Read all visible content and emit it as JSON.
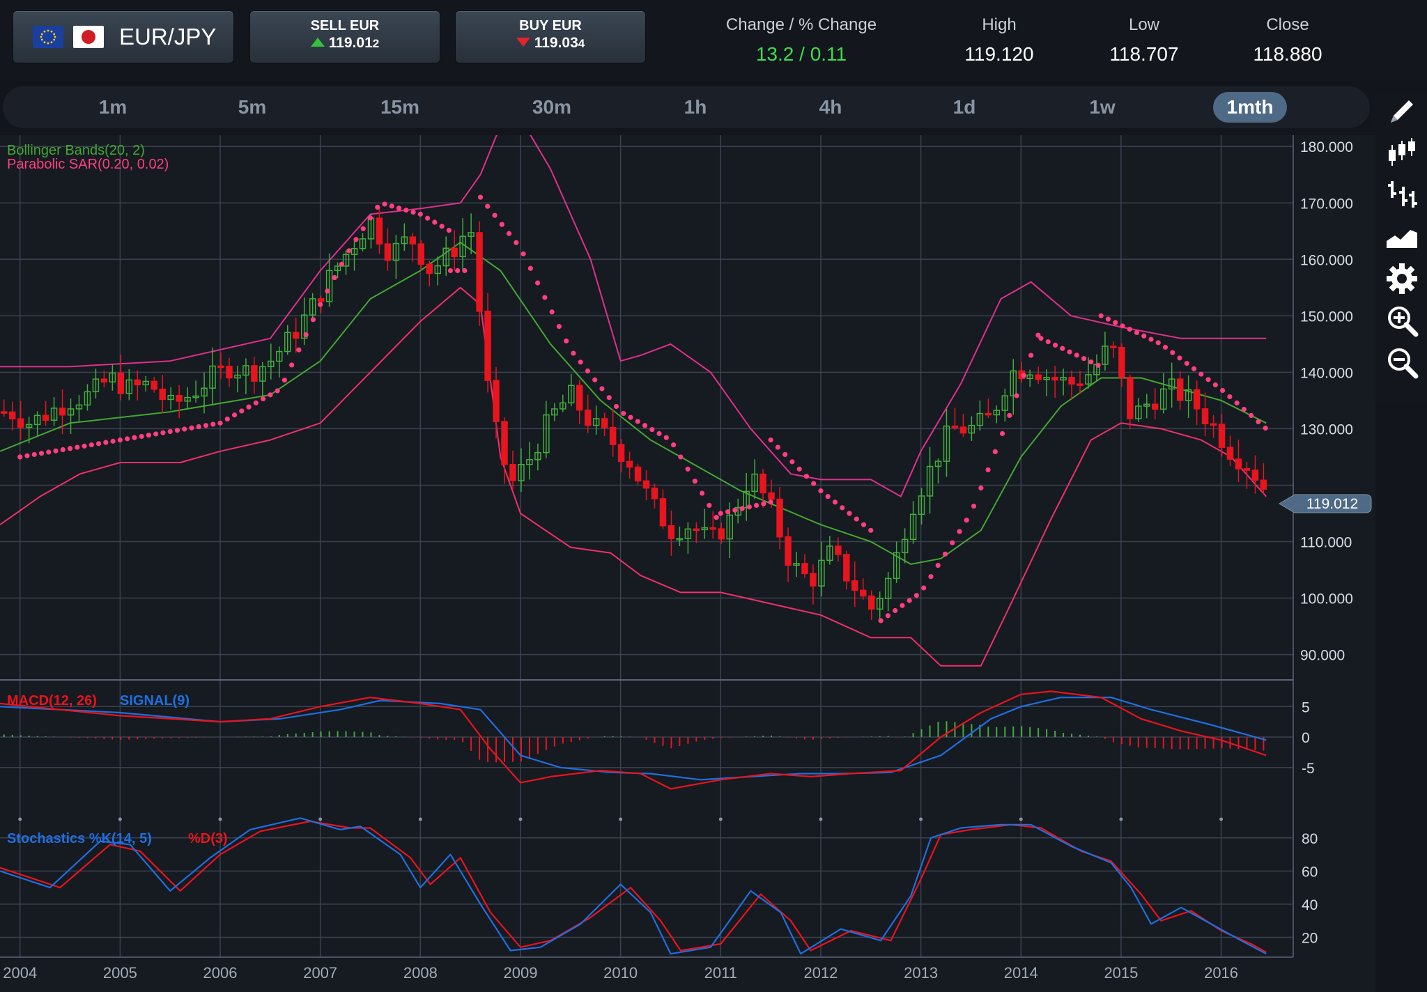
{
  "header": {
    "pair": "EUR/JPY",
    "sell": {
      "label": "SELL EUR",
      "price_main": "119.01",
      "price_tail": "2"
    },
    "buy": {
      "label": "BUY EUR",
      "price_main": "119.03",
      "price_tail": "4"
    },
    "change_label": "Change / % Change",
    "change_value": "13.2 / 0.11",
    "high_label": "High",
    "high_value": "119.120",
    "low_label": "Low",
    "low_value": "118.707",
    "close_label": "Close",
    "close_value": "118.880"
  },
  "timeframes": [
    "1m",
    "5m",
    "15m",
    "30m",
    "1h",
    "4h",
    "1d",
    "1w",
    "1mth"
  ],
  "active_timeframe": "1mth",
  "tools": [
    "pencil-icon",
    "candlestick-icon",
    "ohlc-bars-icon",
    "area-chart-icon",
    "gear-icon",
    "zoom-in-icon",
    "zoom-out-icon"
  ],
  "colors": {
    "bollinger": "#43a832",
    "sar": "#ff3f7f",
    "up": "#3fae3a",
    "down": "#e8141e",
    "macd": "#e8141e",
    "signal": "#1f6fe0",
    "price_tag": "#4e6a86"
  },
  "chart_data": [
    {
      "type": "candlestick",
      "indicators": [
        "Bollinger Bands(20, 2)",
        "Parabolic SAR(0.20, 0.02)"
      ],
      "price_tag": "119.012",
      "y_ticks": [
        "180.000",
        "170.000",
        "160.000",
        "150.000",
        "140.000",
        "130.000",
        "110.000",
        "100.000",
        "90.000"
      ],
      "ylim": [
        86,
        182
      ],
      "x_ticks": [
        "2004",
        "2005",
        "2006",
        "2007",
        "2008",
        "2009",
        "2010",
        "2011",
        "2012",
        "2013",
        "2014",
        "2015",
        "2016"
      ],
      "xlim": [
        2003.8,
        2016.72
      ],
      "grid": true,
      "close_series": [
        [
          2003.9,
          133
        ],
        [
          2004.1,
          131
        ],
        [
          2004.3,
          133
        ],
        [
          2004.5,
          135
        ],
        [
          2004.7,
          136
        ],
        [
          2004.9,
          139
        ],
        [
          2005.1,
          137
        ],
        [
          2005.3,
          138
        ],
        [
          2005.5,
          134
        ],
        [
          2005.7,
          136
        ],
        [
          2005.9,
          139
        ],
        [
          2006.1,
          141
        ],
        [
          2006.3,
          140
        ],
        [
          2006.5,
          142
        ],
        [
          2006.7,
          146
        ],
        [
          2006.9,
          151
        ],
        [
          2007.1,
          157
        ],
        [
          2007.3,
          162
        ],
        [
          2007.5,
          167
        ],
        [
          2007.7,
          161
        ],
        [
          2007.9,
          164
        ],
        [
          2008.1,
          158
        ],
        [
          2008.3,
          161
        ],
        [
          2008.5,
          166
        ],
        [
          2008.7,
          133
        ],
        [
          2008.9,
          120
        ],
        [
          2009.1,
          125
        ],
        [
          2009.3,
          132
        ],
        [
          2009.5,
          136
        ],
        [
          2009.7,
          131
        ],
        [
          2009.9,
          128
        ],
        [
          2010.1,
          124
        ],
        [
          2010.3,
          117
        ],
        [
          2010.5,
          112
        ],
        [
          2010.7,
          113
        ],
        [
          2010.9,
          110
        ],
        [
          2011.1,
          114
        ],
        [
          2011.3,
          122
        ],
        [
          2011.5,
          116
        ],
        [
          2011.7,
          106
        ],
        [
          2011.9,
          103
        ],
        [
          2012.1,
          108
        ],
        [
          2012.3,
          103
        ],
        [
          2012.5,
          98
        ],
        [
          2012.7,
          104
        ],
        [
          2012.9,
          116
        ],
        [
          2013.1,
          123
        ],
        [
          2013.3,
          130
        ],
        [
          2013.5,
          130
        ],
        [
          2013.7,
          132
        ],
        [
          2013.9,
          140
        ],
        [
          2014.1,
          141
        ],
        [
          2014.3,
          139
        ],
        [
          2014.5,
          138
        ],
        [
          2014.7,
          140
        ],
        [
          2014.9,
          145
        ],
        [
          2015.1,
          132
        ],
        [
          2015.3,
          135
        ],
        [
          2015.5,
          137
        ],
        [
          2015.7,
          135
        ],
        [
          2015.9,
          131
        ],
        [
          2016.1,
          126
        ],
        [
          2016.3,
          123
        ],
        [
          2016.45,
          119
        ]
      ],
      "bollinger_upper": [
        [
          2003.8,
          141
        ],
        [
          2004.5,
          141
        ],
        [
          2005.5,
          142
        ],
        [
          2006.5,
          146
        ],
        [
          2007.0,
          158
        ],
        [
          2007.5,
          168
        ],
        [
          2008.0,
          169
        ],
        [
          2008.4,
          170
        ],
        [
          2008.6,
          175
        ],
        [
          2008.9,
          188
        ],
        [
          2009.3,
          176
        ],
        [
          2009.7,
          160
        ],
        [
          2010.0,
          142
        ],
        [
          2010.2,
          143
        ],
        [
          2010.5,
          145
        ],
        [
          2010.9,
          140
        ],
        [
          2011.3,
          130
        ],
        [
          2011.7,
          122
        ],
        [
          2012.0,
          121
        ],
        [
          2012.5,
          121
        ],
        [
          2012.8,
          118
        ],
        [
          2013.0,
          126
        ],
        [
          2013.4,
          138
        ],
        [
          2013.8,
          153
        ],
        [
          2014.1,
          156
        ],
        [
          2014.5,
          150
        ],
        [
          2015.0,
          148
        ],
        [
          2015.6,
          146
        ],
        [
          2016.0,
          146
        ],
        [
          2016.45,
          146
        ]
      ],
      "bollinger_mid": [
        [
          2003.8,
          126
        ],
        [
          2004.5,
          131
        ],
        [
          2005.5,
          133
        ],
        [
          2006.5,
          136
        ],
        [
          2007.0,
          142
        ],
        [
          2007.5,
          153
        ],
        [
          2008.0,
          158
        ],
        [
          2008.4,
          163
        ],
        [
          2008.8,
          158
        ],
        [
          2009.3,
          145
        ],
        [
          2009.8,
          135
        ],
        [
          2010.3,
          128
        ],
        [
          2010.7,
          124
        ],
        [
          2011.2,
          119
        ],
        [
          2011.6,
          116
        ],
        [
          2012.0,
          113
        ],
        [
          2012.5,
          110
        ],
        [
          2012.9,
          106
        ],
        [
          2013.2,
          107
        ],
        [
          2013.6,
          112
        ],
        [
          2014.0,
          125
        ],
        [
          2014.4,
          134
        ],
        [
          2014.8,
          139
        ],
        [
          2015.2,
          139
        ],
        [
          2015.6,
          137
        ],
        [
          2016.0,
          135
        ],
        [
          2016.45,
          131
        ]
      ],
      "bollinger_lower": [
        [
          2003.8,
          113
        ],
        [
          2004.2,
          118
        ],
        [
          2004.6,
          122
        ],
        [
          2005.0,
          124
        ],
        [
          2005.6,
          124
        ],
        [
          2006.0,
          126
        ],
        [
          2006.5,
          128
        ],
        [
          2007.0,
          131
        ],
        [
          2007.5,
          140
        ],
        [
          2008.0,
          149
        ],
        [
          2008.4,
          155
        ],
        [
          2008.6,
          152
        ],
        [
          2008.8,
          125
        ],
        [
          2009.0,
          115
        ],
        [
          2009.5,
          109
        ],
        [
          2009.9,
          108
        ],
        [
          2010.2,
          104
        ],
        [
          2010.6,
          101
        ],
        [
          2011.0,
          101
        ],
        [
          2011.5,
          99
        ],
        [
          2012.0,
          97
        ],
        [
          2012.5,
          93
        ],
        [
          2012.9,
          93
        ],
        [
          2013.2,
          88
        ],
        [
          2013.6,
          88
        ],
        [
          2013.9,
          99
        ],
        [
          2014.3,
          114
        ],
        [
          2014.7,
          128
        ],
        [
          2015.0,
          131
        ],
        [
          2015.4,
          130
        ],
        [
          2015.8,
          128
        ],
        [
          2016.1,
          125
        ],
        [
          2016.45,
          118
        ]
      ],
      "sar_series": [
        [
          [
            2004.0,
            125
          ],
          [
            2005.0,
            128
          ],
          [
            2006.0,
            131
          ],
          [
            2006.6,
            137
          ],
          [
            2007.0,
            152
          ],
          [
            2007.3,
            162
          ],
          [
            2007.6,
            170
          ],
          [
            2008.0,
            168
          ],
          [
            2008.3,
            165
          ]
        ],
        [
          [
            2008.3,
            158
          ],
          [
            2008.5,
            158
          ]
        ],
        [
          [
            2008.6,
            171
          ],
          [
            2009.0,
            162
          ],
          [
            2009.5,
            144
          ],
          [
            2010.0,
            133
          ],
          [
            2010.5,
            128
          ],
          [
            2011.0,
            113
          ]
        ],
        [
          [
            2011.0,
            115
          ],
          [
            2011.5,
            117
          ]
        ],
        [
          [
            2011.5,
            128
          ],
          [
            2012.0,
            119
          ],
          [
            2012.5,
            112
          ]
        ],
        [
          [
            2012.6,
            96
          ],
          [
            2013.0,
            101
          ],
          [
            2013.5,
            115
          ],
          [
            2013.9,
            133
          ],
          [
            2014.2,
            148
          ]
        ],
        [
          [
            2014.2,
            146
          ],
          [
            2014.8,
            141
          ]
        ],
        [
          [
            2014.8,
            150
          ],
          [
            2015.4,
            145
          ],
          [
            2016.0,
            137
          ],
          [
            2016.45,
            130
          ]
        ]
      ]
    },
    {
      "type": "line",
      "indicator": "MACD(12, 26)",
      "signal_label": "SIGNAL(9)",
      "y_ticks": [
        "5",
        "0",
        "-5"
      ],
      "ylim": [
        -8,
        8
      ],
      "macd": [
        [
          2003.8,
          5.5
        ],
        [
          2005.0,
          3.5
        ],
        [
          2006.0,
          2.5
        ],
        [
          2006.5,
          3
        ],
        [
          2007.0,
          5
        ],
        [
          2007.5,
          6.5
        ],
        [
          2008.0,
          5.5
        ],
        [
          2008.4,
          4.5
        ],
        [
          2008.7,
          -2
        ],
        [
          2009.0,
          -7.5
        ],
        [
          2009.3,
          -6.5
        ],
        [
          2009.8,
          -5.5
        ],
        [
          2010.2,
          -6
        ],
        [
          2010.5,
          -8.5
        ],
        [
          2011.0,
          -7
        ],
        [
          2011.5,
          -6
        ],
        [
          2011.9,
          -6.5
        ],
        [
          2012.3,
          -6
        ],
        [
          2012.8,
          -5.5
        ],
        [
          2013.2,
          0
        ],
        [
          2013.6,
          4
        ],
        [
          2014.0,
          7
        ],
        [
          2014.3,
          7.5
        ],
        [
          2014.8,
          6.5
        ],
        [
          2015.2,
          3
        ],
        [
          2015.6,
          1
        ],
        [
          2016.0,
          -0.5
        ],
        [
          2016.45,
          -3
        ]
      ],
      "signal": [
        [
          2003.8,
          5
        ],
        [
          2005.0,
          4
        ],
        [
          2006.0,
          2.5
        ],
        [
          2006.6,
          3
        ],
        [
          2007.2,
          4.5
        ],
        [
          2007.6,
          6
        ],
        [
          2008.2,
          5.5
        ],
        [
          2008.6,
          4.5
        ],
        [
          2009.0,
          -3
        ],
        [
          2009.4,
          -5
        ],
        [
          2009.9,
          -5.8
        ],
        [
          2010.3,
          -6
        ],
        [
          2010.8,
          -7
        ],
        [
          2011.3,
          -6.5
        ],
        [
          2011.8,
          -6
        ],
        [
          2012.2,
          -6
        ],
        [
          2012.7,
          -5.8
        ],
        [
          2013.2,
          -3
        ],
        [
          2013.7,
          3
        ],
        [
          2014.0,
          5
        ],
        [
          2014.4,
          6.5
        ],
        [
          2014.9,
          6.5
        ],
        [
          2015.3,
          4.5
        ],
        [
          2015.9,
          2
        ],
        [
          2016.45,
          -0.5
        ]
      ]
    },
    {
      "type": "line",
      "indicator": "Stochastics %K(14, 5)",
      "signal_label": "%D(3)",
      "y_ticks": [
        "80",
        "60",
        "40",
        "20"
      ],
      "ylim": [
        8,
        98
      ],
      "k": [
        [
          2003.8,
          60
        ],
        [
          2004.3,
          50
        ],
        [
          2004.8,
          78
        ],
        [
          2005.1,
          76
        ],
        [
          2005.5,
          48
        ],
        [
          2005.9,
          68
        ],
        [
          2006.3,
          85
        ],
        [
          2006.8,
          92
        ],
        [
          2007.2,
          85
        ],
        [
          2007.4,
          87
        ],
        [
          2007.8,
          70
        ],
        [
          2008.0,
          50
        ],
        [
          2008.3,
          70
        ],
        [
          2008.6,
          40
        ],
        [
          2008.9,
          12
        ],
        [
          2009.2,
          14
        ],
        [
          2009.6,
          28
        ],
        [
          2010.0,
          52
        ],
        [
          2010.3,
          35
        ],
        [
          2010.5,
          10
        ],
        [
          2010.9,
          14
        ],
        [
          2011.3,
          48
        ],
        [
          2011.6,
          35
        ],
        [
          2011.8,
          10
        ],
        [
          2012.2,
          25
        ],
        [
          2012.6,
          18
        ],
        [
          2012.9,
          45
        ],
        [
          2013.1,
          80
        ],
        [
          2013.4,
          86
        ],
        [
          2013.8,
          88
        ],
        [
          2014.1,
          88
        ],
        [
          2014.5,
          75
        ],
        [
          2014.9,
          65
        ],
        [
          2015.1,
          50
        ],
        [
          2015.3,
          28
        ],
        [
          2015.6,
          38
        ],
        [
          2015.9,
          28
        ],
        [
          2016.2,
          18
        ],
        [
          2016.45,
          10
        ]
      ],
      "d": [
        [
          2003.8,
          62
        ],
        [
          2004.4,
          50
        ],
        [
          2004.9,
          76
        ],
        [
          2005.2,
          72
        ],
        [
          2005.6,
          48
        ],
        [
          2006.0,
          70
        ],
        [
          2006.4,
          84
        ],
        [
          2006.9,
          90
        ],
        [
          2007.3,
          86
        ],
        [
          2007.5,
          86
        ],
        [
          2007.9,
          68
        ],
        [
          2008.1,
          52
        ],
        [
          2008.4,
          68
        ],
        [
          2008.7,
          35
        ],
        [
          2009.0,
          14
        ],
        [
          2009.3,
          18
        ],
        [
          2009.7,
          32
        ],
        [
          2010.1,
          50
        ],
        [
          2010.4,
          30
        ],
        [
          2010.6,
          12
        ],
        [
          2011.0,
          16
        ],
        [
          2011.4,
          46
        ],
        [
          2011.7,
          30
        ],
        [
          2011.9,
          12
        ],
        [
          2012.3,
          24
        ],
        [
          2012.7,
          18
        ],
        [
          2013.0,
          55
        ],
        [
          2013.2,
          82
        ],
        [
          2013.5,
          85
        ],
        [
          2013.9,
          88
        ],
        [
          2014.2,
          86
        ],
        [
          2014.6,
          72
        ],
        [
          2014.9,
          66
        ],
        [
          2015.2,
          46
        ],
        [
          2015.4,
          30
        ],
        [
          2015.7,
          36
        ],
        [
          2016.0,
          24
        ],
        [
          2016.3,
          16
        ],
        [
          2016.45,
          11
        ]
      ]
    }
  ]
}
